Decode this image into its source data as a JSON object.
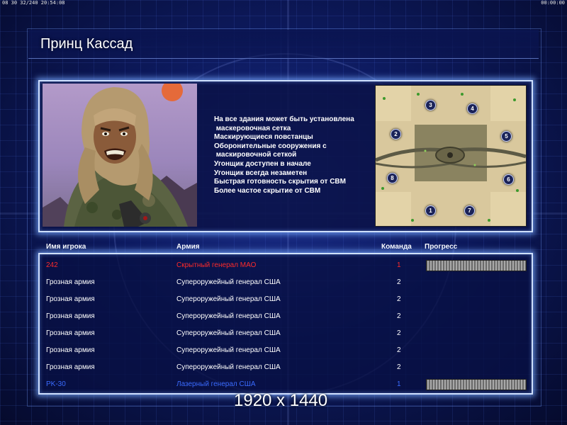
{
  "status_bar": {
    "left": "08 30 32/240 20:54:08",
    "right": "00:00:00"
  },
  "title": "Принц Кассад",
  "description_lines": [
    "На все здания может быть установлена",
    " маскеровочная сетка",
    "Маскирующиеся повстанцы",
    "Оборонительные сооружения с",
    " маскировочной сеткой",
    "Угонщик доступен в начале",
    "Угонщик всегда незаметен",
    "Быстрая готовность скрытия от СВМ",
    "Более частое скрытие от СВМ"
  ],
  "minimap": {
    "start_positions": [
      "1",
      "2",
      "3",
      "4",
      "5",
      "6",
      "7",
      "8"
    ]
  },
  "table": {
    "headers": {
      "name": "Имя игрока",
      "army": "Армия",
      "team": "Команда",
      "progress": "Прогресс"
    },
    "rows": [
      {
        "name": "242",
        "army": "Скрытный генерал МАО",
        "team": "1",
        "color": "#ff2a2a",
        "progress": 0.0
      },
      {
        "name": "Грозная армия",
        "army": "Супероружейный генерал США",
        "team": "2",
        "color": "#ffffff"
      },
      {
        "name": "Грозная армия",
        "army": "Супероружейный генерал США",
        "team": "2",
        "color": "#ffffff"
      },
      {
        "name": "Грозная армия",
        "army": "Супероружейный генерал США",
        "team": "2",
        "color": "#ffffff"
      },
      {
        "name": "Грозная армия",
        "army": "Супероружейный генерал США",
        "team": "2",
        "color": "#ffffff"
      },
      {
        "name": "Грозная армия",
        "army": "Супероружейный генерал США",
        "team": "2",
        "color": "#ffffff"
      },
      {
        "name": "Грозная армия",
        "army": "Супероружейный генерал США",
        "team": "2",
        "color": "#ffffff"
      },
      {
        "name": "PK-30",
        "army": "Лазерный генерал США",
        "team": "1",
        "color": "#3a6bff",
        "progress": 0.0
      }
    ]
  },
  "resolution_label": "1920 x 1440"
}
